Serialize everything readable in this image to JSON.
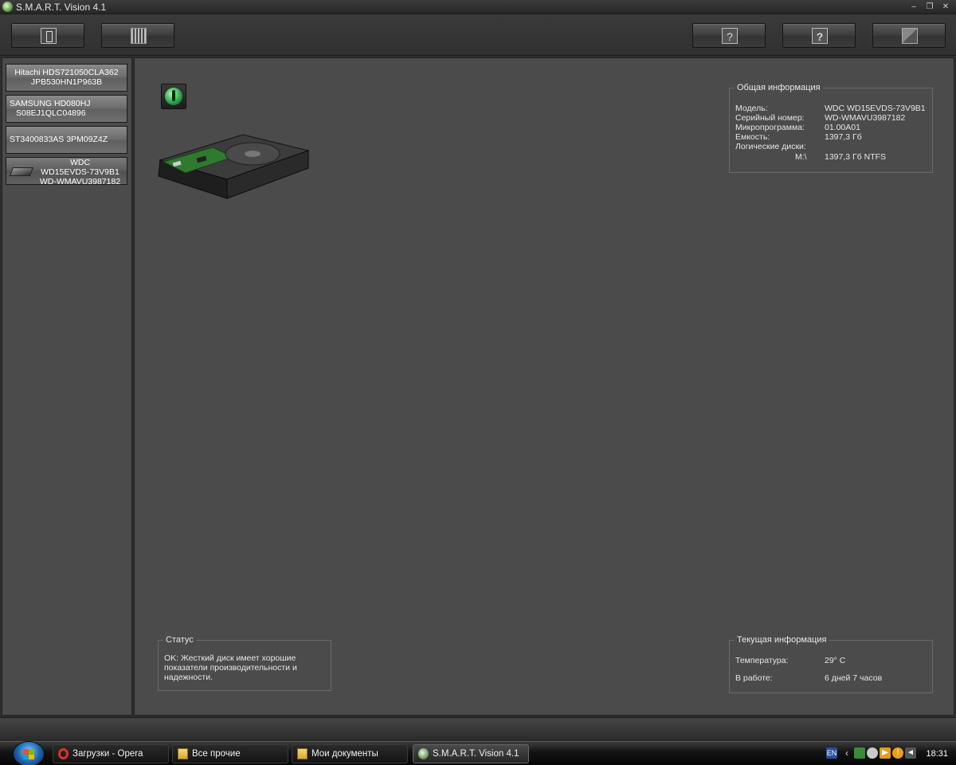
{
  "window": {
    "title": "S.M.A.R.T. Vision 4.1"
  },
  "disks": [
    {
      "line1": "Hitachi HDS721050CLA362",
      "line2": "JPB530HN1P963B"
    },
    {
      "line1": "SAMSUNG HD080HJ",
      "line2": "S08EJ1QLC04896"
    },
    {
      "line1": "ST3400833AS 3PM09Z4Z",
      "line2": ""
    },
    {
      "line1": "WDC",
      "line2": "WD15EVDS-73V9B1",
      "line3": "WD-WMAVU3987182"
    }
  ],
  "general_info": {
    "legend": "Общая информация",
    "model_label": "Модель:",
    "model_value": "WDC WD15EVDS-73V9B1",
    "serial_label": "Серийный номер:",
    "serial_value": "WD-WMAVU3987182",
    "firmware_label": "Микропрограмма:",
    "firmware_value": "01.00A01",
    "capacity_label": "Емкость:",
    "capacity_value": "1397,3 Гб",
    "logical_label": "Логические диски:",
    "logical_drive": "M:\\",
    "logical_value": "1397,3 Гб  NTFS"
  },
  "status": {
    "legend": "Статус",
    "text": "OK: Жесткий диск имеет хорошие показатели производительности и надежности."
  },
  "current_info": {
    "legend": "Текущая информация",
    "temp_label": "Температура:",
    "temp_value": "29° C",
    "uptime_label": "В работе:",
    "uptime_value": "6 дней 7 часов"
  },
  "taskbar": {
    "tasks": [
      {
        "label": "Загрузки - Opera",
        "icon": "opera-icon"
      },
      {
        "label": "Все прочие",
        "icon": "folder-icon"
      },
      {
        "label": "Мои документы",
        "icon": "folder-icon"
      },
      {
        "label": "S.M.A.R.T. Vision 4.1",
        "icon": "smart-vision-icon"
      }
    ],
    "language": "EN",
    "clock": "18:31"
  }
}
